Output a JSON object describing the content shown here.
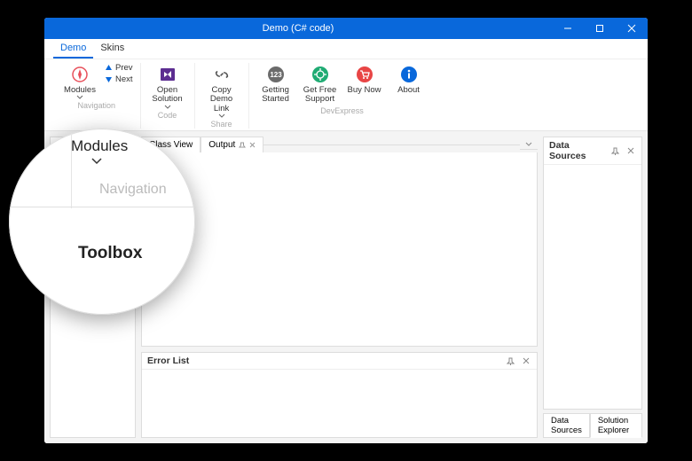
{
  "titlebar": {
    "title": "Demo (C# code)"
  },
  "tabs": {
    "demo": "Demo",
    "skins": "Skins"
  },
  "ribbon": {
    "modules": "Modules",
    "prev": "Prev",
    "next": "Next",
    "nav_group": "Navigation",
    "open_solution": "Open Solution",
    "code_group": "Code",
    "copy_link": "Copy Demo Link",
    "share_group": "Share",
    "getting_started": "Getting Started",
    "get_support": "Get Free Support",
    "buy_now": "Buy Now",
    "about": "About",
    "dx_group": "DevExpress"
  },
  "panels": {
    "toolbox": "Toolbox",
    "class_view": "Class View",
    "output": "Output",
    "data_sources": "Data Sources",
    "error_list": "Error List",
    "solution_explorer": "Solution Explorer"
  },
  "magnifier": {
    "modules": "Modules",
    "navigation": "Navigation",
    "toolbox": "Toolbox"
  },
  "icons": {
    "num_badge": "123"
  }
}
